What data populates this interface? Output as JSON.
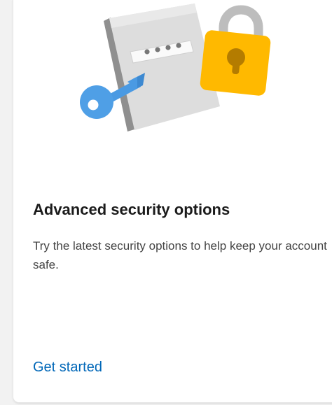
{
  "card": {
    "illustration": {
      "icons": [
        "password-book-icon",
        "key-icon",
        "padlock-icon"
      ],
      "colors": {
        "book": "#dcdcdc",
        "book_spine": "#8a8a8a",
        "key": "#4a9ae3",
        "lock_body": "#ffb900",
        "lock_shackle": "#bdbdbd",
        "keyhole": "#b47c00"
      }
    },
    "title": "Advanced security options",
    "description": "Try the latest security options to help keep your account safe.",
    "link_label": "Get started",
    "link_color": "#0067b8"
  }
}
